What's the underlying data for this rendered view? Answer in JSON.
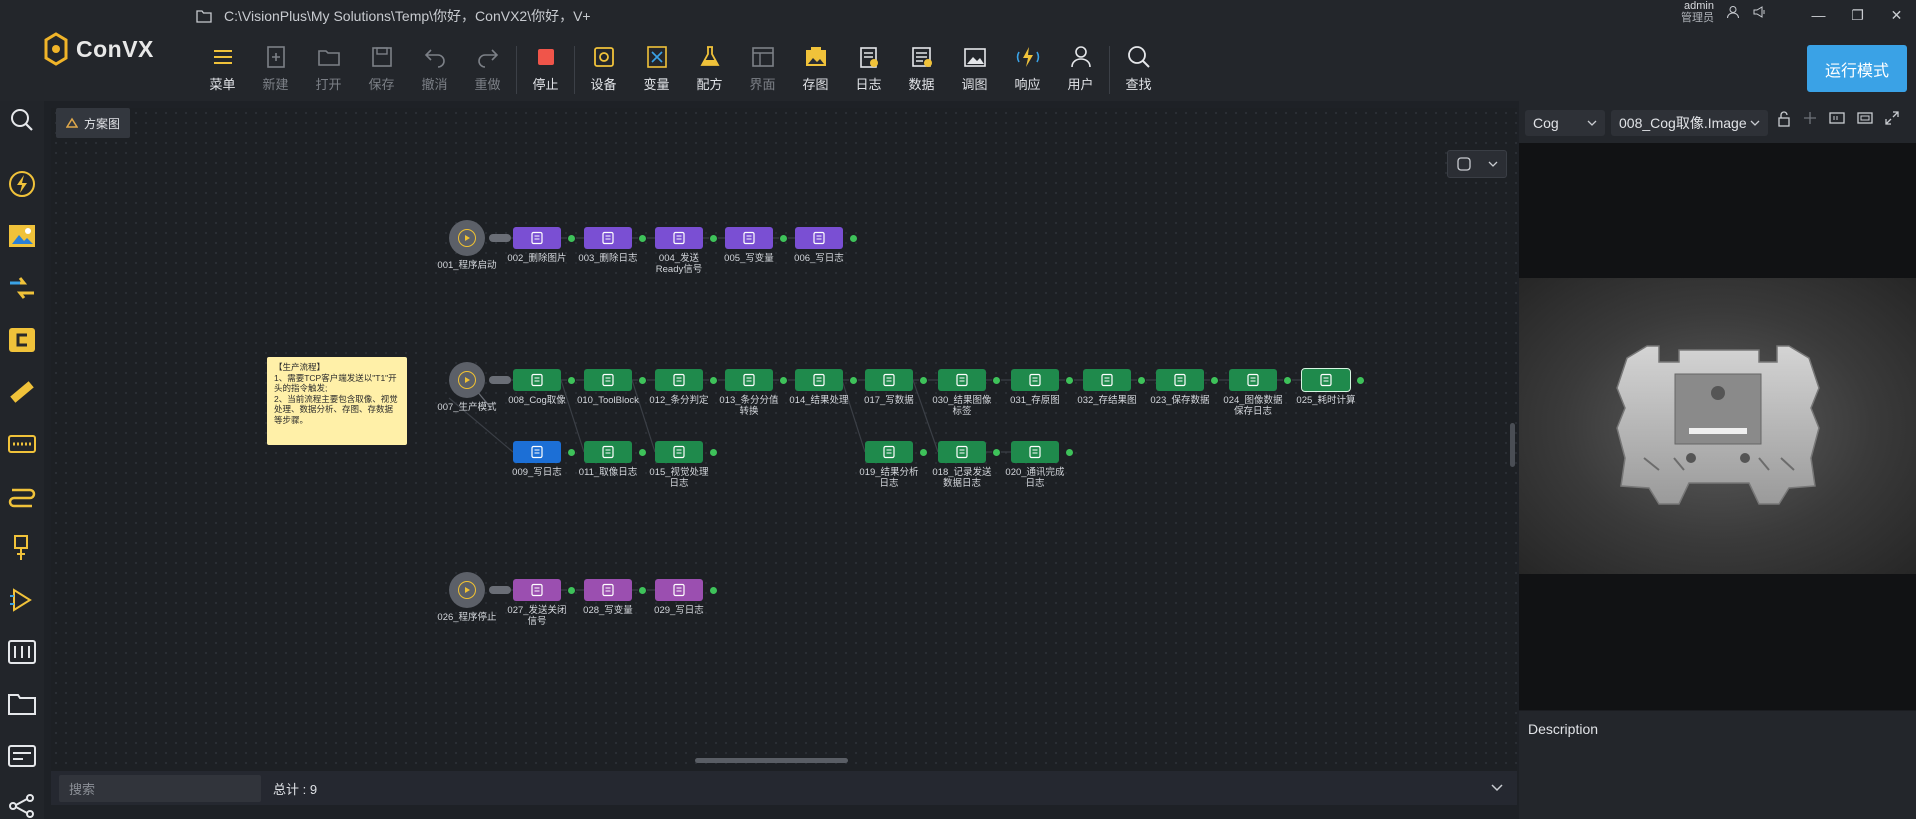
{
  "window": {
    "path": "C:\\VisionPlus\\My Solutions\\Temp\\你好，ConVX2\\你好，V+",
    "user": "admin",
    "role": "管理员"
  },
  "app": {
    "logo_text": "ConVX",
    "run_mode_label": "运行模式"
  },
  "toolbar": [
    {
      "label": "菜单",
      "icon": "menu-icon",
      "enabled": true
    },
    {
      "label": "新建",
      "icon": "new-file-icon",
      "enabled": false
    },
    {
      "label": "打开",
      "icon": "folder-open-icon",
      "enabled": false
    },
    {
      "label": "保存",
      "icon": "save-icon",
      "enabled": false
    },
    {
      "label": "撤消",
      "icon": "undo-icon",
      "enabled": false
    },
    {
      "label": "重做",
      "icon": "redo-icon",
      "enabled": false
    },
    {
      "label": "停止",
      "icon": "stop-icon",
      "enabled": true
    },
    {
      "label": "设备",
      "icon": "device-icon",
      "enabled": true
    },
    {
      "label": "变量",
      "icon": "variable-icon",
      "enabled": true
    },
    {
      "label": "配方",
      "icon": "recipe-flask-icon",
      "enabled": true
    },
    {
      "label": "界面",
      "icon": "interface-icon",
      "enabled": false
    },
    {
      "label": "存图",
      "icon": "save-image-icon",
      "enabled": true
    },
    {
      "label": "日志",
      "icon": "log-icon",
      "enabled": true
    },
    {
      "label": "数据",
      "icon": "data-icon",
      "enabled": true
    },
    {
      "label": "调图",
      "icon": "load-image-icon",
      "enabled": true
    },
    {
      "label": "响应",
      "icon": "response-icon",
      "enabled": true
    },
    {
      "label": "用户",
      "icon": "user-icon",
      "enabled": true
    },
    {
      "label": "查找",
      "icon": "search-icon",
      "enabled": true
    }
  ],
  "canvas": {
    "tab_label": "方案图",
    "note": "【生产流程】\n1、需要TCP客户端发送以\"T1\"开头的指令触发;\n2、当前流程主要包含取像、视觉处理、数据分析、存图、存数据等步骤。",
    "flows": [
      {
        "start_label": "001_程序启动",
        "nodes": [
          "002_删除图片",
          "003_删除日志",
          "004_发送Ready信号",
          "005_写变量",
          "006_写日志"
        ]
      },
      {
        "start_label": "007_生产模式",
        "nodes": [
          "008_Cog取像",
          "010_ToolBlock",
          "012_条分判定",
          "013_条分分值转换",
          "014_结果处理",
          "017_写数据",
          "030_结果图像标签",
          "031_存原图",
          "032_存结果图",
          "023_保存数据",
          "024_图像数据保存日志",
          "025_耗时计算"
        ],
        "branch_nodes": [
          "009_写日志",
          "011_取像日志",
          "015_视觉处理日志",
          "019_结果分析日志",
          "018_记录发送数据日志",
          "020_通讯完成日志"
        ]
      },
      {
        "start_label": "026_程序停止",
        "nodes": [
          "027_发送关闭信号",
          "028_写变量",
          "029_写日志"
        ]
      }
    ]
  },
  "bottom": {
    "search_placeholder": "搜索",
    "total_label": "总计 : 9"
  },
  "right_panel": {
    "camera_select": "Cog",
    "image_select": "008_Cog取像.Image",
    "description_title": "Description"
  }
}
